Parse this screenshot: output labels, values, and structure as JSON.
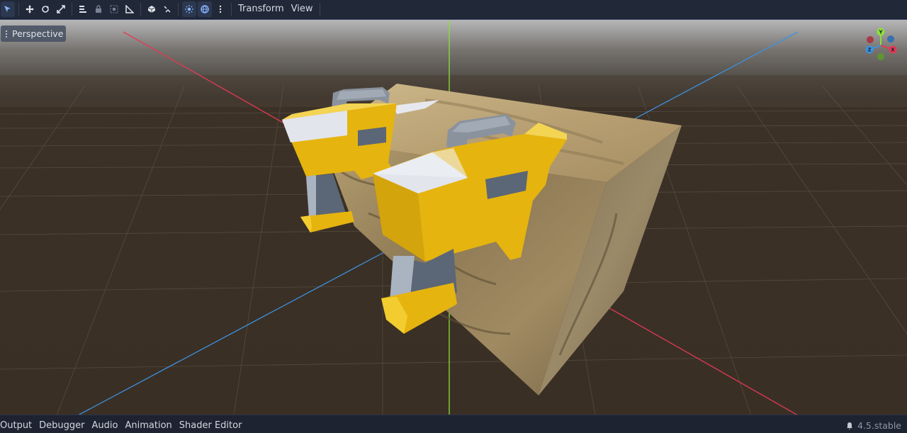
{
  "toolbar": {
    "buttons": [
      {
        "icon": "select-mode-icon",
        "active": true
      },
      {
        "icon": "move-mode-icon",
        "active": false
      },
      {
        "icon": "rotate-mode-icon",
        "active": false
      },
      {
        "icon": "scale-mode-icon",
        "active": false
      },
      {
        "icon": "list-select-icon",
        "active": false
      },
      {
        "icon": "lock-icon",
        "active": false
      },
      {
        "icon": "group-icon",
        "active": false
      },
      {
        "icon": "ruler-icon",
        "active": false
      },
      {
        "icon": "snap-icon",
        "active": false
      },
      {
        "icon": "bone-icon",
        "active": false
      },
      {
        "icon": "sun-preview-icon",
        "active": true
      },
      {
        "icon": "environment-preview-icon",
        "active": true
      },
      {
        "icon": "more-options-icon",
        "active": false
      }
    ],
    "menus": [
      "Transform",
      "View"
    ]
  },
  "viewport": {
    "perspective_label": "Perspective",
    "gizmo_axes": [
      "Y",
      "X",
      "Z"
    ],
    "axis_colors": {
      "x": "#e23a55",
      "y": "#8be03a",
      "z": "#3c92e0"
    }
  },
  "bottom_panel": {
    "tabs": [
      "Output",
      "Debugger",
      "Audio",
      "Animation",
      "Shader Editor"
    ],
    "version": "4.5.stable"
  }
}
